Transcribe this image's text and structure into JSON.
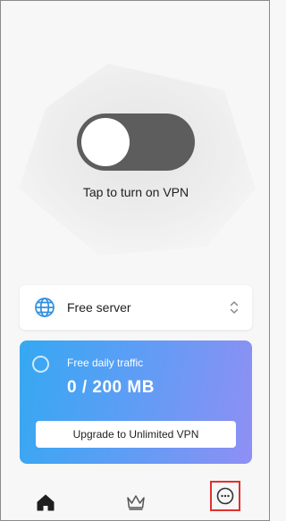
{
  "vpn": {
    "toggle_state": "off",
    "tap_label": "Tap to turn on VPN"
  },
  "server": {
    "icon": "globe-icon",
    "label": "Free server",
    "selector_icon": "chevron-up-down-icon"
  },
  "traffic": {
    "title": "Free daily traffic",
    "value": "0 / 200 MB",
    "used_fraction": 0,
    "upgrade_label": "Upgrade to Unlimited VPN"
  },
  "bottom_nav": {
    "items": [
      {
        "name": "home",
        "icon": "home-icon",
        "selected": true
      },
      {
        "name": "premium",
        "icon": "crown-icon",
        "selected": false
      },
      {
        "name": "more",
        "icon": "more-icon",
        "highlighted": true
      }
    ]
  },
  "colors": {
    "background": "#f7f7f7",
    "toggle_track": "#5d5d5d",
    "card_gradient_start": "#35a8f2",
    "card_gradient_end": "#8f8ff4",
    "globe": "#2f8fe0",
    "highlight_box": "#e0312f"
  }
}
